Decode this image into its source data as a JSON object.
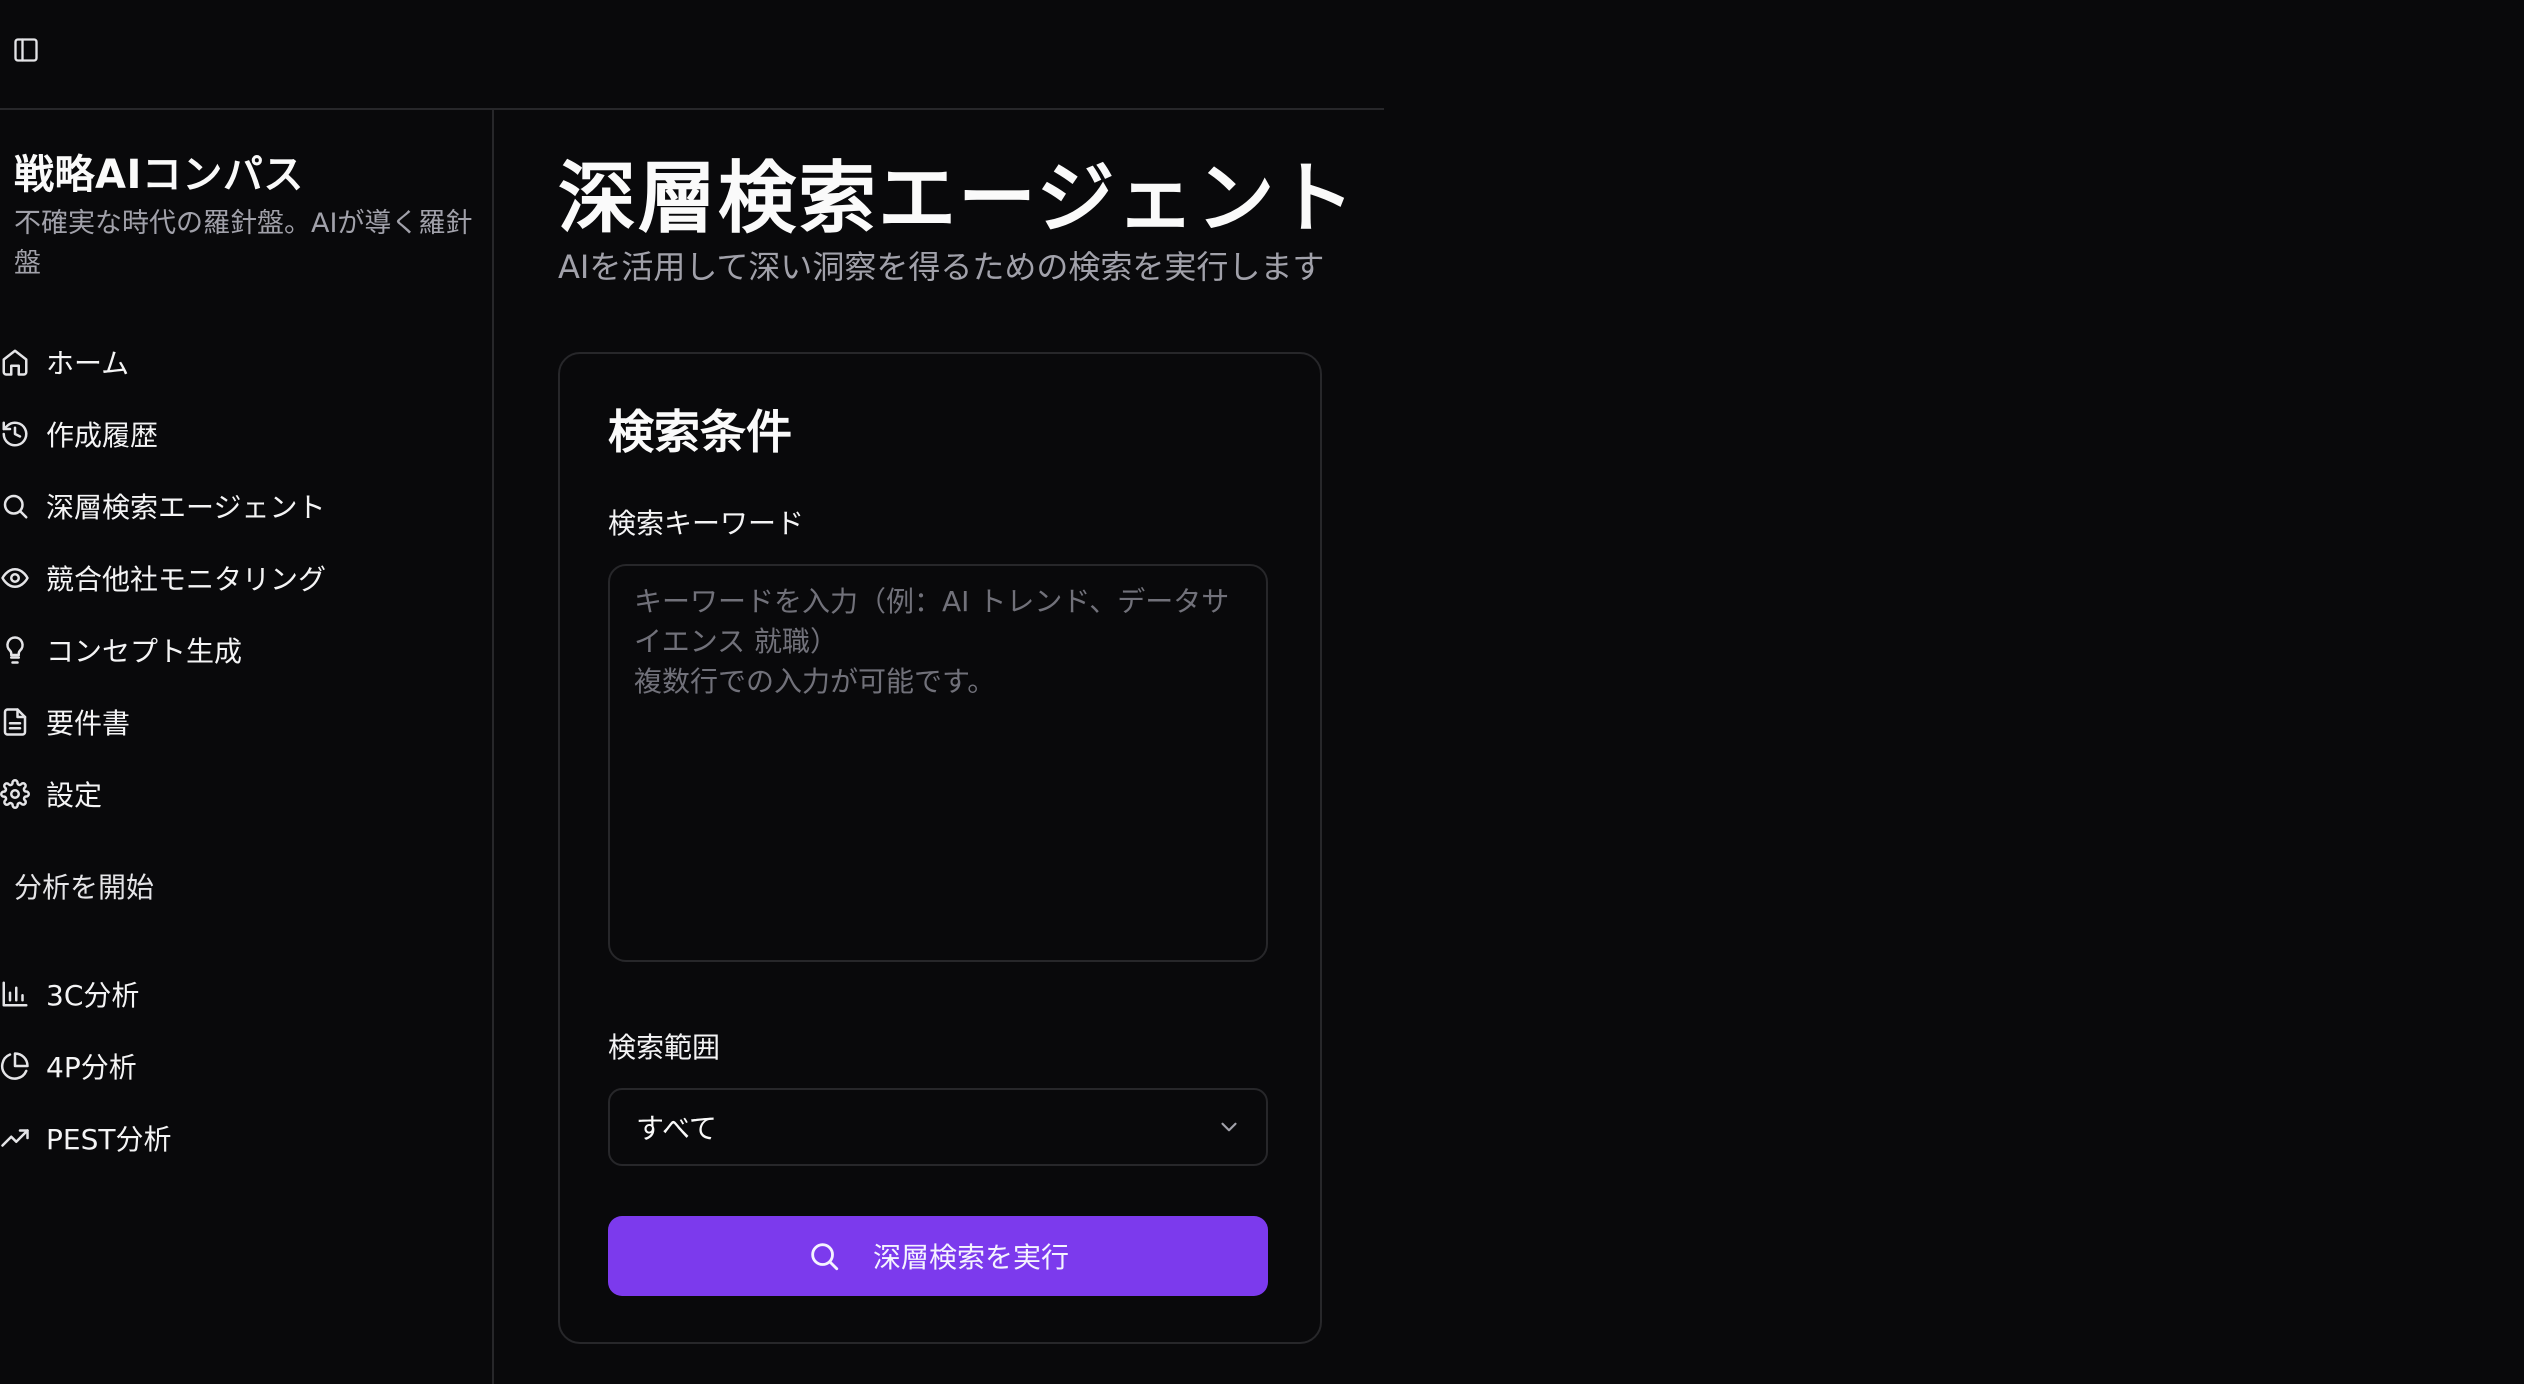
{
  "sidebar": {
    "brand_title": "戦略AIコンパス",
    "brand_subtitle": "不確実な時代の羅針盤。AIが導く羅針盤",
    "nav": [
      {
        "label": "ホーム",
        "icon": "home-icon"
      },
      {
        "label": "作成履歴",
        "icon": "history-icon"
      },
      {
        "label": "深層検索エージェント",
        "icon": "search-icon"
      },
      {
        "label": "競合他社モニタリング",
        "icon": "eye-icon"
      },
      {
        "label": "コンセプト生成",
        "icon": "lightbulb-icon"
      },
      {
        "label": "要件書",
        "icon": "document-icon"
      },
      {
        "label": "設定",
        "icon": "gear-icon"
      }
    ],
    "section_label": "分析を開始",
    "analysis": [
      {
        "label": "3C分析",
        "icon": "bar-chart-icon"
      },
      {
        "label": "4P分析",
        "icon": "pie-chart-icon"
      },
      {
        "label": "PEST分析",
        "icon": "trending-up-icon"
      }
    ]
  },
  "main": {
    "title": "深層検索エージェント",
    "subtitle": "AIを活用して深い洞察を得るための検索を実行します",
    "card": {
      "title": "検索条件",
      "keyword_label": "検索キーワード",
      "keyword_value": "",
      "keyword_placeholder": "キーワードを入力（例：AI トレンド、データサイエンス 就職）\n複数行での入力が可能です。",
      "scope_label": "検索範囲",
      "scope_value": "すべて",
      "submit_label": "深層検索を実行"
    }
  },
  "colors": {
    "background": "#09090b",
    "border": "#27272a",
    "accent": "#7c3aed",
    "muted_text": "#a1a1aa"
  }
}
